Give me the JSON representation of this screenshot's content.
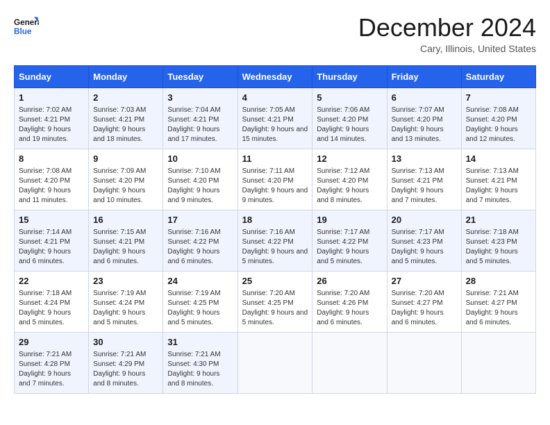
{
  "logo": {
    "text_general": "General",
    "text_blue": "Blue"
  },
  "title": "December 2024",
  "location": "Cary, Illinois, United States",
  "days_of_week": [
    "Sunday",
    "Monday",
    "Tuesday",
    "Wednesday",
    "Thursday",
    "Friday",
    "Saturday"
  ],
  "weeks": [
    [
      {
        "day": "1",
        "sunrise": "7:02 AM",
        "sunset": "4:21 PM",
        "daylight_hours": "9 hours and 19 minutes."
      },
      {
        "day": "2",
        "sunrise": "7:03 AM",
        "sunset": "4:21 PM",
        "daylight_hours": "9 hours and 18 minutes."
      },
      {
        "day": "3",
        "sunrise": "7:04 AM",
        "sunset": "4:21 PM",
        "daylight_hours": "9 hours and 17 minutes."
      },
      {
        "day": "4",
        "sunrise": "7:05 AM",
        "sunset": "4:21 PM",
        "daylight_hours": "9 hours and 15 minutes."
      },
      {
        "day": "5",
        "sunrise": "7:06 AM",
        "sunset": "4:20 PM",
        "daylight_hours": "9 hours and 14 minutes."
      },
      {
        "day": "6",
        "sunrise": "7:07 AM",
        "sunset": "4:20 PM",
        "daylight_hours": "9 hours and 13 minutes."
      },
      {
        "day": "7",
        "sunrise": "7:08 AM",
        "sunset": "4:20 PM",
        "daylight_hours": "9 hours and 12 minutes."
      }
    ],
    [
      {
        "day": "8",
        "sunrise": "7:08 AM",
        "sunset": "4:20 PM",
        "daylight_hours": "9 hours and 11 minutes."
      },
      {
        "day": "9",
        "sunrise": "7:09 AM",
        "sunset": "4:20 PM",
        "daylight_hours": "9 hours and 10 minutes."
      },
      {
        "day": "10",
        "sunrise": "7:10 AM",
        "sunset": "4:20 PM",
        "daylight_hours": "9 hours and 9 minutes."
      },
      {
        "day": "11",
        "sunrise": "7:11 AM",
        "sunset": "4:20 PM",
        "daylight_hours": "9 hours and 9 minutes."
      },
      {
        "day": "12",
        "sunrise": "7:12 AM",
        "sunset": "4:20 PM",
        "daylight_hours": "9 hours and 8 minutes."
      },
      {
        "day": "13",
        "sunrise": "7:13 AM",
        "sunset": "4:21 PM",
        "daylight_hours": "9 hours and 7 minutes."
      },
      {
        "day": "14",
        "sunrise": "7:13 AM",
        "sunset": "4:21 PM",
        "daylight_hours": "9 hours and 7 minutes."
      }
    ],
    [
      {
        "day": "15",
        "sunrise": "7:14 AM",
        "sunset": "4:21 PM",
        "daylight_hours": "9 hours and 6 minutes."
      },
      {
        "day": "16",
        "sunrise": "7:15 AM",
        "sunset": "4:21 PM",
        "daylight_hours": "9 hours and 6 minutes."
      },
      {
        "day": "17",
        "sunrise": "7:16 AM",
        "sunset": "4:22 PM",
        "daylight_hours": "9 hours and 6 minutes."
      },
      {
        "day": "18",
        "sunrise": "7:16 AM",
        "sunset": "4:22 PM",
        "daylight_hours": "9 hours and 5 minutes."
      },
      {
        "day": "19",
        "sunrise": "7:17 AM",
        "sunset": "4:22 PM",
        "daylight_hours": "9 hours and 5 minutes."
      },
      {
        "day": "20",
        "sunrise": "7:17 AM",
        "sunset": "4:23 PM",
        "daylight_hours": "9 hours and 5 minutes."
      },
      {
        "day": "21",
        "sunrise": "7:18 AM",
        "sunset": "4:23 PM",
        "daylight_hours": "9 hours and 5 minutes."
      }
    ],
    [
      {
        "day": "22",
        "sunrise": "7:18 AM",
        "sunset": "4:24 PM",
        "daylight_hours": "9 hours and 5 minutes."
      },
      {
        "day": "23",
        "sunrise": "7:19 AM",
        "sunset": "4:24 PM",
        "daylight_hours": "9 hours and 5 minutes."
      },
      {
        "day": "24",
        "sunrise": "7:19 AM",
        "sunset": "4:25 PM",
        "daylight_hours": "9 hours and 5 minutes."
      },
      {
        "day": "25",
        "sunrise": "7:20 AM",
        "sunset": "4:25 PM",
        "daylight_hours": "9 hours and 5 minutes."
      },
      {
        "day": "26",
        "sunrise": "7:20 AM",
        "sunset": "4:26 PM",
        "daylight_hours": "9 hours and 6 minutes."
      },
      {
        "day": "27",
        "sunrise": "7:20 AM",
        "sunset": "4:27 PM",
        "daylight_hours": "9 hours and 6 minutes."
      },
      {
        "day": "28",
        "sunrise": "7:21 AM",
        "sunset": "4:27 PM",
        "daylight_hours": "9 hours and 6 minutes."
      }
    ],
    [
      {
        "day": "29",
        "sunrise": "7:21 AM",
        "sunset": "4:28 PM",
        "daylight_hours": "9 hours and 7 minutes."
      },
      {
        "day": "30",
        "sunrise": "7:21 AM",
        "sunset": "4:29 PM",
        "daylight_hours": "9 hours and 8 minutes."
      },
      {
        "day": "31",
        "sunrise": "7:21 AM",
        "sunset": "4:30 PM",
        "daylight_hours": "9 hours and 8 minutes."
      },
      null,
      null,
      null,
      null
    ]
  ],
  "labels": {
    "sunrise": "Sunrise: ",
    "sunset": "Sunset: ",
    "daylight": "Daylight: "
  }
}
